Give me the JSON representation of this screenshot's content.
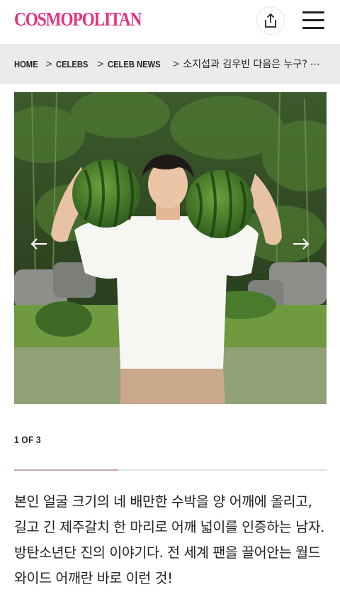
{
  "header": {
    "logo_text": "COSMOPOLITAN",
    "brand_color": "#e6307c",
    "share_icon": "share-icon",
    "menu_icon": "hamburger-menu-icon"
  },
  "breadcrumb": {
    "items": [
      "HOME",
      "CELEBS",
      "CELEB NEWS"
    ],
    "current": "소지섭과 김우빈 다음은 누구?",
    "more": "⋯",
    "separator": ">"
  },
  "gallery": {
    "image_alt": "Person in white t-shirt holding two watermelons on shoulders",
    "prev_icon": "arrow-left-icon",
    "next_icon": "arrow-right-icon",
    "counter_text": "1 OF 3",
    "progress": 0.3333
  },
  "article": {
    "paragraph": "본인 얼굴 크기의 네 배만한 수박을 양 어깨에 올리고, 길고 긴 제주갈치 한 마리로 어깨 넓이를 인증하는 남자. 방탄소년단 진의 이야기다. 전 세계 팬을 끌어안는 월드 와이드 어깨란 바로 이런 것!"
  }
}
